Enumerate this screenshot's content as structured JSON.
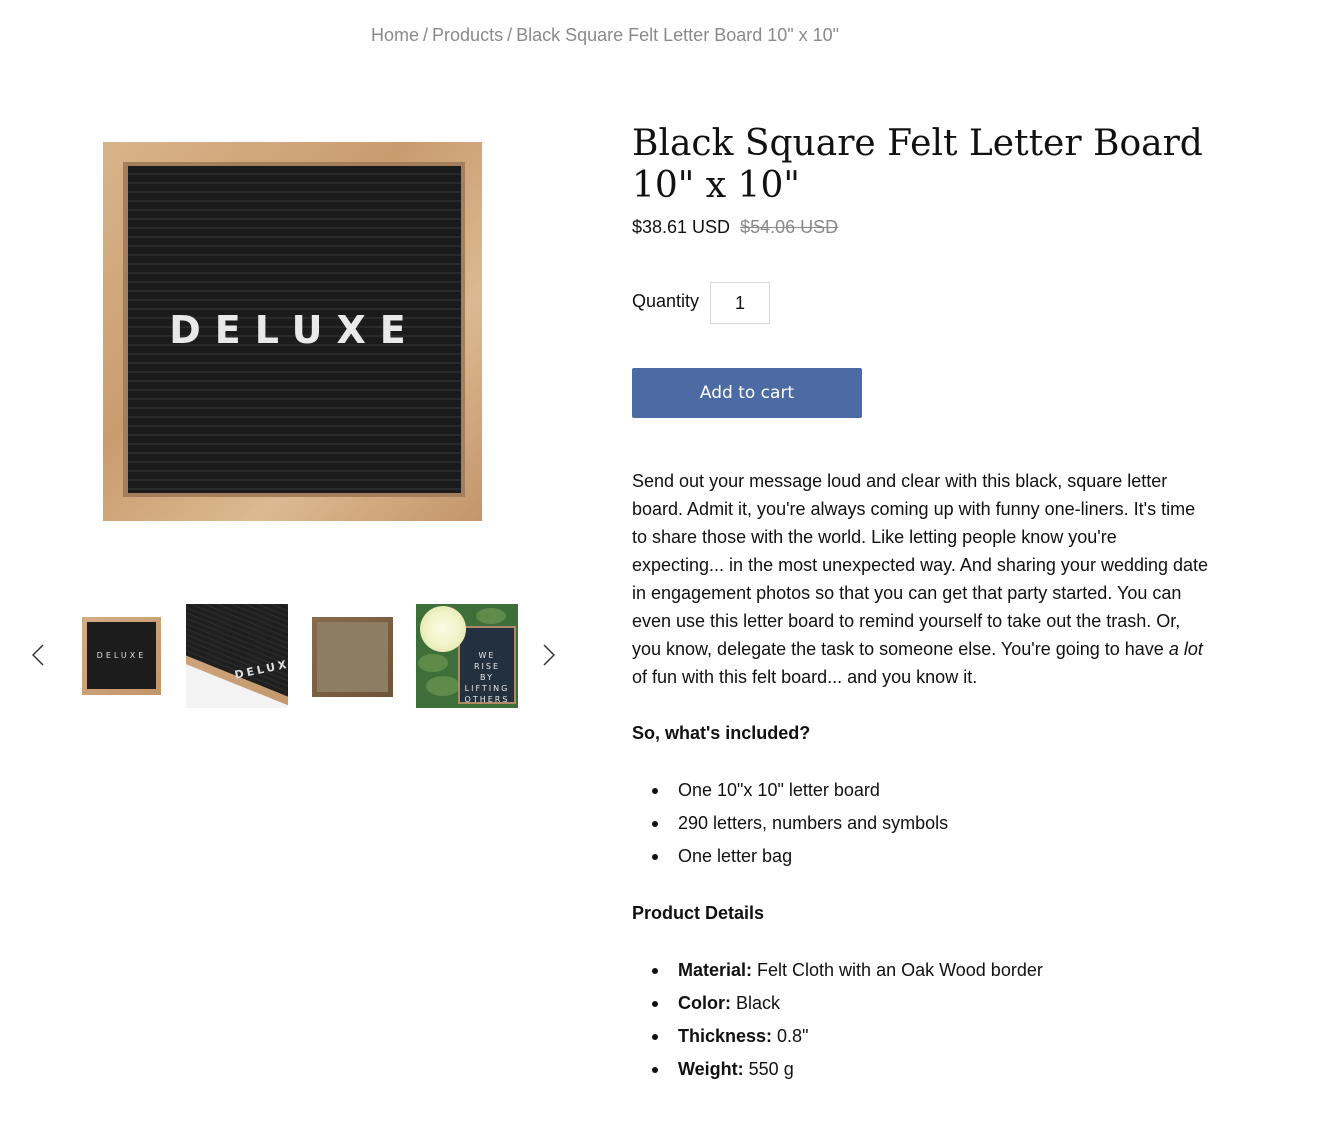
{
  "breadcrumb": {
    "home": "Home",
    "products": "Products",
    "current": "Black Square Felt Letter Board 10\" x 10\"",
    "separator": "/"
  },
  "gallery": {
    "main_image_text": "DELUXE",
    "thumbnails": [
      {
        "text": "DELUXE"
      },
      {
        "text": "DELUXE"
      },
      {
        "text": ""
      },
      {
        "text": "WE\nRISE\nBY\nLIFTING\nOTHERS"
      }
    ]
  },
  "product": {
    "title": "Black Square Felt Letter Board 10\" x 10\"",
    "price": "$38.61 USD",
    "compare_price": "$54.06 USD",
    "quantity_label": "Quantity",
    "quantity_value": "1",
    "add_to_cart_label": "Add to cart"
  },
  "description": {
    "paragraph_before": "Send out your message loud and clear with this black, square letter board. Admit it, you're always coming up with funny one-liners. It's time to share those with the world. Like letting people know you're expecting... in the most unexpected way. And sharing your wedding date in engagement photos so that you can get that party started. You can even use this letter board to remind yourself to take out the trash. Or, you know, delegate the task to someone else. You're going to have ",
    "paragraph_emphasis": "a lot",
    "paragraph_after": " of fun with this felt board... and you know it.",
    "included_heading": "So, what's included?",
    "included_items": [
      "One 10\"x 10\" letter board",
      "290 letters, numbers and symbols",
      "One letter bag"
    ],
    "details_heading": "Product Details",
    "details": [
      {
        "label": "Material:",
        "value": " Felt Cloth with an Oak Wood border"
      },
      {
        "label": "Color:",
        "value": " Black"
      },
      {
        "label": "Thickness:",
        "value": " 0.8\""
      },
      {
        "label": "Weight:",
        "value": " 550 g"
      }
    ]
  },
  "colors": {
    "button": "#4c6ba5",
    "breadcrumb": "#8a8a8a"
  },
  "icons": {
    "prev": "chevron-left-icon",
    "next": "chevron-right-icon"
  }
}
